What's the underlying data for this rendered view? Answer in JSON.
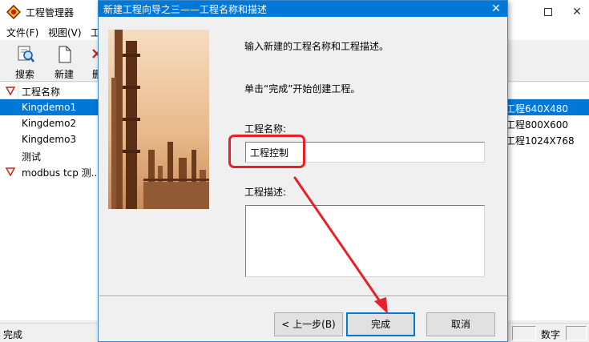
{
  "main_window": {
    "title": "工程管理器",
    "menus": [
      "文件(F)",
      "视图(V)",
      "工"
    ],
    "toolbar": {
      "search_label": "搜索",
      "new_label": "新建",
      "delete_label_partial": "删"
    },
    "list": {
      "header": {
        "name_col": "工程名称"
      },
      "rows": [
        {
          "name": "Kingdemo1",
          "desc": "工程640X480",
          "selected": true
        },
        {
          "name": "Kingdemo2",
          "desc": "工程800X600",
          "selected": false
        },
        {
          "name": "Kingdemo3",
          "desc": "工程1024X768",
          "selected": false
        },
        {
          "name": "测试",
          "desc": "",
          "selected": false
        },
        {
          "name": "modbus tcp 测...",
          "desc": "",
          "selected": false
        }
      ]
    },
    "status": {
      "text": "完成",
      "num_indicator": "数字"
    }
  },
  "wizard": {
    "title": "新建工程向导之三——工程名称和描述",
    "instruction": "输入新建的工程名称和工程描述。",
    "hint": "单击“完成”开始创建工程。",
    "name_label": "工程名称:",
    "name_value": "工程控制",
    "desc_label": "工程描述:",
    "desc_value": "",
    "buttons": {
      "back": "< 上一步(B)",
      "finish": "完成",
      "cancel": "取消"
    }
  },
  "colors": {
    "selection": "#0078d7",
    "highlight": "#e8202a",
    "dialog_title": "#0078d7"
  }
}
